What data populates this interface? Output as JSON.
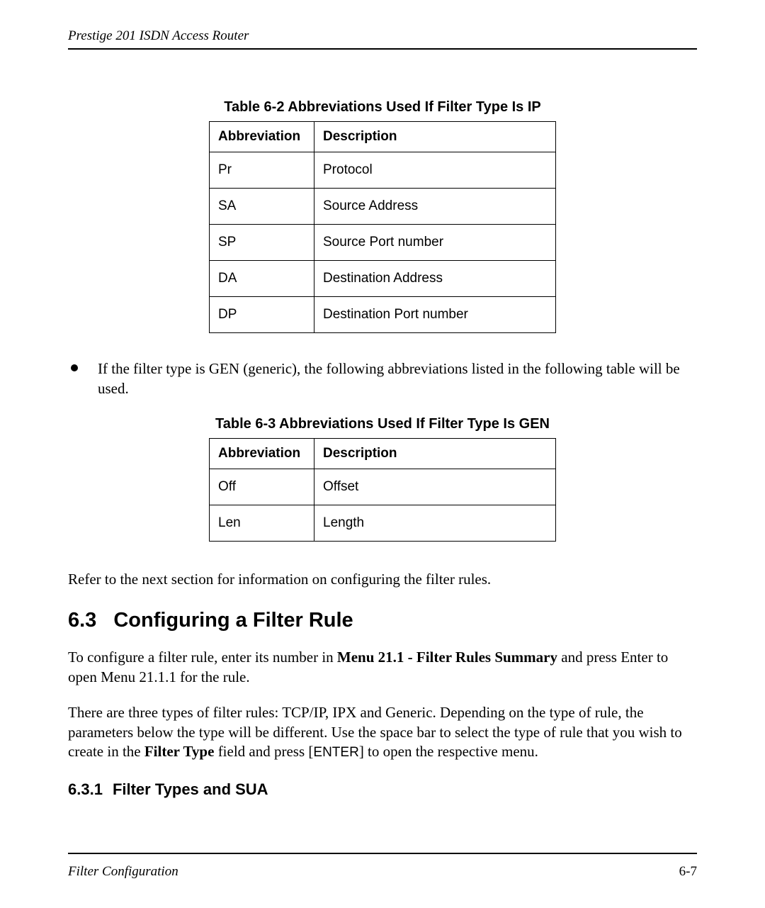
{
  "header": {
    "running_title": "Prestige 201 ISDN Access Router"
  },
  "table1": {
    "caption": "Table 6-2 Abbreviations Used If Filter Type Is IP",
    "col_abbrev": "Abbreviation",
    "col_desc": "Description",
    "rows": [
      {
        "abbr": "Pr",
        "desc": "Protocol"
      },
      {
        "abbr": "SA",
        "desc": "Source Address"
      },
      {
        "abbr": "SP",
        "desc": "Source Port number"
      },
      {
        "abbr": "DA",
        "desc": "Destination Address"
      },
      {
        "abbr": "DP",
        "desc": "Destination Port number"
      }
    ]
  },
  "bullet1": "If the filter type is GEN (generic), the following abbreviations listed in the following table will be used.",
  "table2": {
    "caption": "Table 6-3  Abbreviations Used If Filter Type Is GEN",
    "col_abbrev": "Abbreviation",
    "col_desc": "Description",
    "rows": [
      {
        "abbr": "Off",
        "desc": "Offset"
      },
      {
        "abbr": "Len",
        "desc": "Length"
      }
    ]
  },
  "para_refer": "Refer to the next section for information on configuring the filter rules.",
  "section": {
    "number": "6.3",
    "title": "Configuring a Filter Rule"
  },
  "para_config_1a": "To configure a filter rule, enter its number in ",
  "para_config_1b_bold": "Menu 21.1 - Filter Rules Summary",
  "para_config_1c": " and press Enter to open Menu 21.1.1 for the rule.",
  "para_types_a": "There are three types of filter rules: TCP/IP, IPX and Generic.  Depending on the type of rule, the parameters below the type will be different.  Use the space bar to select the type of rule that you wish to create in the ",
  "para_types_b_bold": "Filter Type",
  "para_types_c": " field and press [",
  "para_types_key": "ENTER",
  "para_types_d": "] to open the respective menu.",
  "subsection": {
    "number": "6.3.1",
    "title": "Filter Types and SUA"
  },
  "footer": {
    "section": "Filter Configuration",
    "page": "6-7"
  }
}
